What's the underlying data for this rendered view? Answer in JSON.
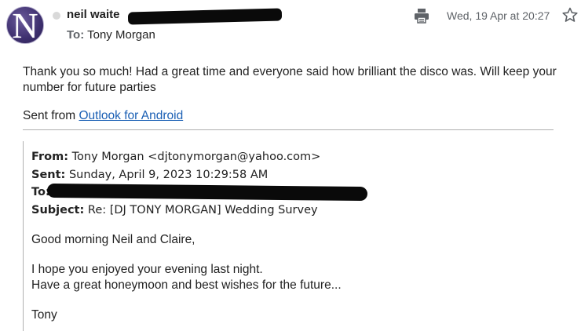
{
  "message": {
    "avatar_letter": "N",
    "sender_name": "neil waite",
    "to_label": "To:",
    "to_name": "Tony Morgan",
    "date": "Wed, 19 Apr at 20:27",
    "body": "Thank you so much! Had a great time and everyone said how brilliant the disco was. Will keep your number for future parties",
    "sent_from_prefix": "Sent from ",
    "sent_from_link": "Outlook for Android"
  },
  "quoted": {
    "from_label": "From:",
    "from_value": " Tony Morgan <djtonymorgan@yahoo.com>",
    "sent_label": "Sent:",
    "sent_value": " Sunday, April 9, 2023 10:29:58 AM",
    "to_label": "To:",
    "subject_label": "Subject:",
    "subject_value": " Re: [DJ TONY MORGAN] Wedding Survey",
    "greeting": "Good morning Neil and Claire,",
    "line1": "I hope you enjoyed your evening last night.",
    "line2": "Have a great honeymoon and best wishes for the future...",
    "signoff": "Tony"
  },
  "colors": {
    "link": "#1a5fb4",
    "muted": "#5f6368",
    "avatar_bg": "#3d2f6e",
    "redaction": "#0a0a0a"
  },
  "icons": [
    "print-icon",
    "star-icon"
  ]
}
